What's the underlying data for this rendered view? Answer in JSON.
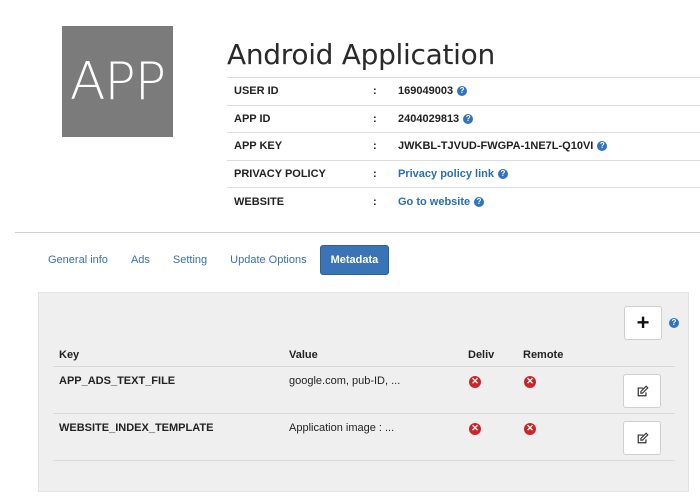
{
  "app": {
    "icon_text": "APP",
    "title": "Android Application"
  },
  "info": [
    {
      "label": "USER ID",
      "value": "169049003",
      "link": false
    },
    {
      "label": "APP ID",
      "value": "2404029813",
      "link": false
    },
    {
      "label": "APP KEY",
      "value": "JWKBL-TJVUD-FWGPA-1NE7L-Q10VI",
      "link": false
    },
    {
      "label": "PRIVACY POLICY",
      "value": "Privacy policy link",
      "link": true
    },
    {
      "label": "WEBSITE",
      "value": "Go to website",
      "link": true
    }
  ],
  "colon": ":",
  "help_glyph": "?",
  "tabs": [
    "General info",
    "Ads",
    "Setting",
    "Update Options",
    "Metadata"
  ],
  "active_tab": "Metadata",
  "panel": {
    "add_label": "+",
    "columns": {
      "key": "Key",
      "value": "Value",
      "deliv": "Deliv",
      "remote": "Remote"
    },
    "rows": [
      {
        "key": "APP_ADS_TEXT_FILE",
        "value": "google.com, pub-ID, ...",
        "deliv": "off",
        "remote": "off"
      },
      {
        "key": "WEBSITE_INDEX_TEMPLATE",
        "value": "Application image : ...",
        "deliv": "off",
        "remote": "off"
      }
    ]
  },
  "icons": {
    "status_off": "x-circle-icon",
    "edit": "edit-icon",
    "help": "help-circle-icon"
  },
  "colors": {
    "accent": "#3a73b6",
    "link": "#2a6db5",
    "error": "#c9262a",
    "icon_bg": "#7b7b7b"
  }
}
